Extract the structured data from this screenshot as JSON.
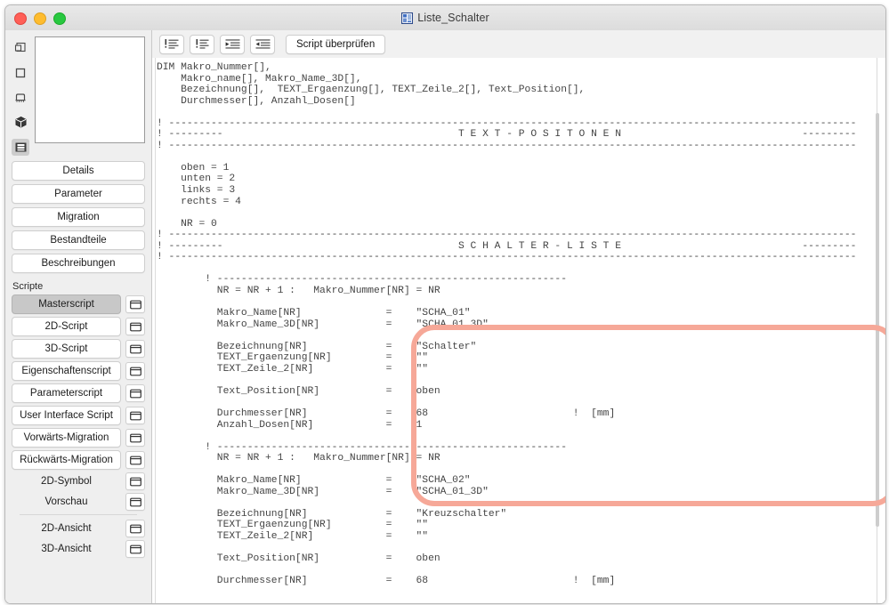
{
  "window": {
    "title": "Liste_Schalter",
    "icon": "app-window-icon",
    "controls": {
      "close": "close",
      "minimize": "minimize",
      "maximize": "maximize"
    }
  },
  "sidebar": {
    "view_icons": [
      {
        "name": "floorplan-symbol-icon",
        "selected": false
      },
      {
        "name": "square-outline-icon",
        "selected": false
      },
      {
        "name": "elevation-view-icon",
        "selected": false
      },
      {
        "name": "cube-3d-icon",
        "selected": false
      },
      {
        "name": "script-film-icon",
        "selected": true
      }
    ],
    "preview": {
      "name": "preview-pane"
    },
    "buttons": [
      {
        "label": "Details"
      },
      {
        "label": "Parameter"
      },
      {
        "label": "Migration"
      },
      {
        "label": "Bestandteile"
      },
      {
        "label": "Beschreibungen"
      }
    ],
    "section_label": "Scripte",
    "scripts": [
      {
        "label": "Masterscript",
        "active": true,
        "plain": false,
        "window_icon": "open-window-icon"
      },
      {
        "label": "2D-Script",
        "active": false,
        "plain": false,
        "window_icon": "open-window-icon"
      },
      {
        "label": "3D-Script",
        "active": false,
        "plain": false,
        "window_icon": "open-window-icon"
      },
      {
        "label": "Eigenschaftenscript",
        "active": false,
        "plain": false,
        "window_icon": "open-window-icon"
      },
      {
        "label": "Parameterscript",
        "active": false,
        "plain": false,
        "window_icon": "open-window-icon"
      },
      {
        "label": "User Interface Script",
        "active": false,
        "plain": false,
        "window_icon": "open-window-icon"
      },
      {
        "label": "Vorwärts-Migration",
        "active": false,
        "plain": false,
        "window_icon": "open-window-icon"
      },
      {
        "label": "Rückwärts-Migration",
        "active": false,
        "plain": false,
        "window_icon": "open-window-icon"
      },
      {
        "label": "2D-Symbol",
        "active": false,
        "plain": true,
        "window_icon": "open-window-icon"
      },
      {
        "label": "Vorschau",
        "active": false,
        "plain": true,
        "window_icon": "open-window-icon"
      }
    ],
    "views": [
      {
        "label": "2D-Ansicht",
        "window_icon": "open-window-icon"
      },
      {
        "label": "3D-Ansicht",
        "window_icon": "open-window-icon"
      }
    ]
  },
  "toolbar": {
    "icons": [
      {
        "name": "comment-lines-icon",
        "title": "Kommentar hinzufügen"
      },
      {
        "name": "uncomment-lines-icon",
        "title": "Kommentar entfernen"
      },
      {
        "name": "indent-increase-icon",
        "title": "Einzug vergrößern"
      },
      {
        "name": "indent-decrease-icon",
        "title": "Einzug verkleinern"
      }
    ],
    "check_script_label": "Script überprüfen"
  },
  "editor": {
    "code": "DIM Makro_Nummer[],\n    Makro_name[], Makro_Name_3D[],\n    Bezeichnung[],  TEXT_Ergaenzung[], TEXT_Zeile_2[], Text_Position[],\n    Durchmesser[], Anzahl_Dosen[]\n\n! ------------------------------------------------------------------------------------------------------------------\n! ---------                                       T E X T - P O S I T O N E N                              ---------\n! ------------------------------------------------------------------------------------------------------------------\n\n    oben = 1\n    unten = 2\n    links = 3\n    rechts = 4\n\n    NR = 0\n! ------------------------------------------------------------------------------------------------------------------\n! ---------                                       S C H A L T E R - L I S T E                              ---------\n! ------------------------------------------------------------------------------------------------------------------\n\n        ! ----------------------------------------------------------\n          NR = NR + 1 :   Makro_Nummer[NR] = NR\n\n          Makro_Name[NR]              =    \"SCHA_01\"\n          Makro_Name_3D[NR]           =    \"SCHA_01_3D\"\n\n          Bezeichnung[NR]             =    \"Schalter\"\n          TEXT_Ergaenzung[NR]         =    \"\"\n          TEXT_Zeile_2[NR]            =    \"\"\n\n          Text_Position[NR]           =    oben\n\n          Durchmesser[NR]             =    68                        !  [mm]\n          Anzahl_Dosen[NR]            =    1\n\n        ! ----------------------------------------------------------\n          NR = NR + 1 :   Makro_Nummer[NR] = NR\n\n          Makro_Name[NR]              =    \"SCHA_02\"\n          Makro_Name_3D[NR]           =    \"SCHA_01_3D\"\n\n          Bezeichnung[NR]             =    \"Kreuzschalter\"\n          TEXT_Ergaenzung[NR]         =    \"\"\n          TEXT_Zeile_2[NR]            =    \"\"\n\n          Text_Position[NR]           =    oben\n\n          Durchmesser[NR]             =    68                        !  [mm]",
    "highlight": {
      "name": "annotation-highlight-oval",
      "color": "#f6a898"
    }
  }
}
